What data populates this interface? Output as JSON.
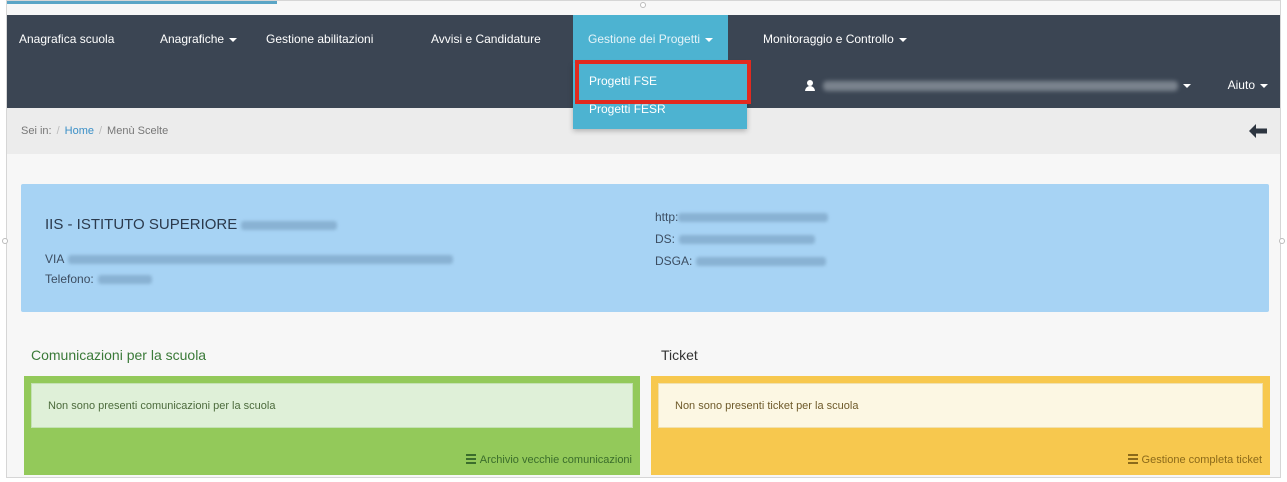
{
  "nav": {
    "items": [
      {
        "label": "Anagrafica scuola",
        "dropdown": false
      },
      {
        "label": "Anagrafiche",
        "dropdown": true
      },
      {
        "label": "Gestione abilitazioni",
        "dropdown": false
      },
      {
        "label": "Avvisi e Candidature",
        "dropdown": false
      },
      {
        "label": "Gestione dei Progetti",
        "dropdown": true,
        "active": true
      },
      {
        "label": "Monitoraggio e Controllo",
        "dropdown": true
      }
    ],
    "dropdown_items": [
      "Progetti FSE",
      "Progetti FESR"
    ],
    "help_label": "Aiuto"
  },
  "breadcrumb": {
    "prefix": "Sei in:",
    "home": "Home",
    "current": "Menù Scelte"
  },
  "school": {
    "name": "IIS - ISTITUTO SUPERIORE",
    "address_label": "VIA",
    "phone_label": "Telefono:",
    "web_label": "http:",
    "ds_label": "DS:",
    "dsga_label": "DSGA:"
  },
  "communications": {
    "title": "Comunicazioni per la scuola",
    "message": "Non sono presenti comunicazioni per la scuola",
    "link": "Archivio vecchie comunicazioni"
  },
  "tickets": {
    "title": "Ticket",
    "message": "Non sono presenti ticket per la scuola",
    "link": "Gestione completa ticket"
  },
  "colors": {
    "navbar": "#3b4553",
    "active_menu": "#4db3d1",
    "highlight": "#e12a1f",
    "school_card": "#a7d3f4",
    "green_panel": "#93c95a",
    "yellow_panel": "#f7c84e"
  }
}
